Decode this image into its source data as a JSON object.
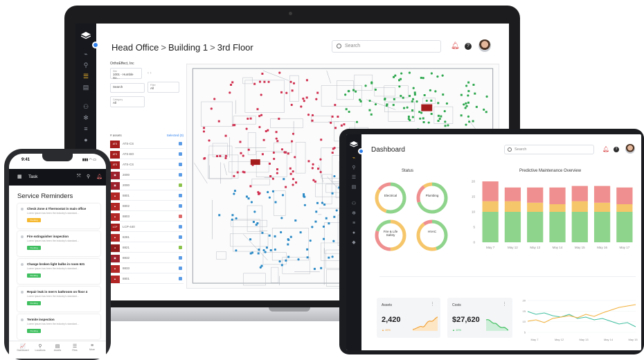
{
  "laptop": {
    "breadcrumb": [
      "Head Office",
      "Building 1",
      "3rd Floor"
    ],
    "search_placeholder": "Search",
    "help_glyph": "?",
    "sidebar_icons": [
      "layers-logo-icon",
      "chart-icon",
      "map-pin-icon",
      "database-icon",
      "document-icon",
      "people-icon",
      "gear-icon",
      "list-icon",
      "info-icon",
      "tag-icon"
    ],
    "panel": {
      "org": "OrthoEffect, Inc",
      "site_label": "Site",
      "site_value": "1001 - Humble So…",
      "search_placeholder": "Search",
      "filter_label": "Filter",
      "filter_value": "All",
      "category_label": "Category",
      "category_value": "All",
      "assets_header": "# assets",
      "assets_action": "Selected (0)",
      "assets": [
        {
          "code": "ATS",
          "name": "ATS-CS"
        },
        {
          "code": "ATS",
          "name": "ATS-BO"
        },
        {
          "code": "ATS",
          "name": "ATS-CS"
        },
        {
          "code": "▣",
          "name": "2000"
        },
        {
          "code": "▣",
          "name": "2000"
        },
        {
          "code": "▲",
          "name": "8801"
        },
        {
          "code": "▲",
          "name": "8802"
        },
        {
          "code": "▲",
          "name": "8803"
        },
        {
          "code": "LCP",
          "name": "LCP-440"
        },
        {
          "code": "▲",
          "name": "8281"
        },
        {
          "code": "●",
          "name": "8821"
        },
        {
          "code": "▣",
          "name": "8832"
        },
        {
          "code": "▲",
          "name": "8833"
        },
        {
          "code": "▲",
          "name": "8801"
        }
      ]
    }
  },
  "tablet": {
    "title": "Dashboard",
    "search_placeholder": "Search",
    "help_glyph": "?",
    "status_title": "Status",
    "rings": [
      "Electrical",
      "Plumbing",
      "Fire & Life Safety",
      "HVAC"
    ],
    "predictive_title": "Predictive Maintenance Overview",
    "chart_data": {
      "type": "bar",
      "stacked": true,
      "categories": [
        "May 7",
        "May 12",
        "May 13",
        "May 14",
        "May 15",
        "May 16",
        "May 17"
      ],
      "yticks": [
        "20",
        "15",
        "10",
        "5",
        "0"
      ],
      "ylim": [
        0,
        20
      ],
      "series": [
        {
          "values": [
            10,
            10,
            10,
            10,
            10,
            10,
            10
          ],
          "color": "#8fd48c"
        },
        {
          "values": [
            3.5,
            3.5,
            3,
            2.5,
            3.5,
            3,
            2.5
          ],
          "color": "#f6c66a"
        },
        {
          "values": [
            6.5,
            4.5,
            5,
            5.5,
            5,
            5.5,
            5.5
          ],
          "color": "#ef8f8f"
        }
      ]
    },
    "assets_label": "Assets",
    "assets_value": "2,420",
    "assets_change": "▲ 49%",
    "costs_label": "Costs",
    "costs_value": "$27,620",
    "costs_change": "▲ 10%",
    "line_yticks": [
      "20",
      "15",
      "10",
      "5"
    ],
    "line_xticks": [
      "May 7",
      "May 12",
      "May 13",
      "May 14",
      "May 15"
    ]
  },
  "phone": {
    "time": "9:41",
    "signal": "▮▮▮ ◠ ▭",
    "bar_label": "Task",
    "heading": "Service Reminders",
    "tasks": [
      {
        "title": "Check Zone 4 Thermostat in main office",
        "desc": "Lorem Ipsum has been the industry's standard...",
        "badge": "Pending",
        "color": "#f5b82e"
      },
      {
        "title": "Fire extinguisher inspection",
        "desc": "Lorem Ipsum has been the industry's standard...",
        "badge": "Pending",
        "color": "#3fbf5f"
      },
      {
        "title": "Change broken light bulbs in room 621",
        "desc": "Lorem Ipsum has been the industry's standard...",
        "badge": "Pending",
        "color": "#3fbf5f"
      },
      {
        "title": "Repair leak in men's bathroom on floor 4",
        "desc": "Lorem Ipsum has been the industry's standard...",
        "badge": "Pending",
        "color": "#3fbf5f"
      },
      {
        "title": "Termite inspection",
        "desc": "Lorem Ipsum has been the industry's standard...",
        "badge": "Pending",
        "color": "#3fbf5f"
      }
    ],
    "tabs": [
      {
        "icon": "📈",
        "label": "Dashboard"
      },
      {
        "icon": "⚲",
        "label": "Locations"
      },
      {
        "icon": "▤",
        "label": "Assets"
      },
      {
        "icon": "☰",
        "label": "Files"
      },
      {
        "icon": "≡",
        "label": "More"
      }
    ]
  }
}
